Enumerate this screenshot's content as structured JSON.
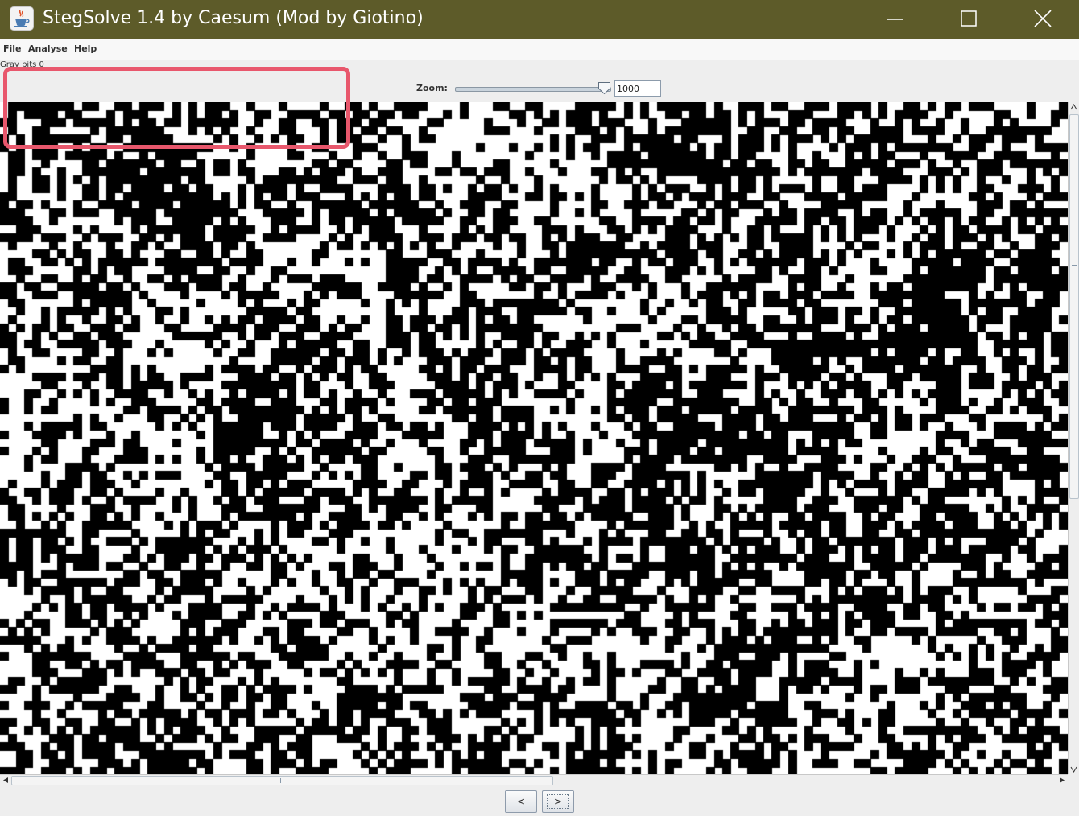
{
  "window": {
    "title": "StegSolve 1.4 by Caesum (Mod by Giotino)",
    "app_icon": "java-coffee-icon",
    "controls": [
      "minimize-icon",
      "maximize-icon",
      "close-icon"
    ]
  },
  "menu": {
    "items": [
      "File",
      "Analyse",
      "Help"
    ]
  },
  "toolbar": {
    "status_text": "Gray bits 0",
    "zoom_label": "Zoom:",
    "zoom_value": "1000",
    "zoom_slider_fraction": 0.97
  },
  "image": {
    "content": "black and white random pixel noise (bit plane view)",
    "colors": {
      "black": "#000000",
      "white": "#ffffff"
    }
  },
  "navigation": {
    "prev_label": "<",
    "next_label": ">"
  },
  "annotation": {
    "highlight_color": "#e8576c"
  }
}
